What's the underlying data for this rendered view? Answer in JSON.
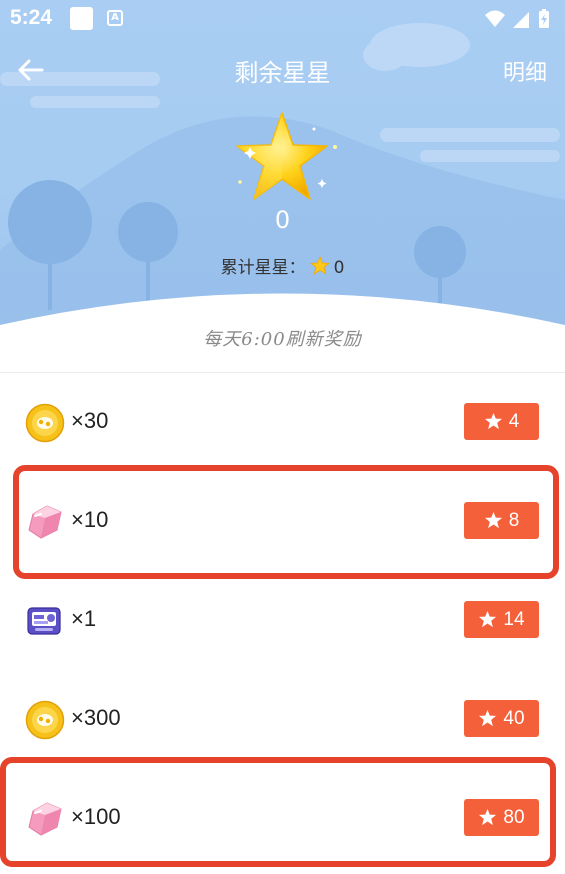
{
  "status_bar": {
    "time": "5:24",
    "a_badge": "A"
  },
  "header": {
    "title": "剩余星星",
    "detail_label": "明细"
  },
  "stars": {
    "remaining": "0",
    "total_label": "累计星星：",
    "total_value": "0"
  },
  "refresh_note": "每天6:00刷新奖励",
  "rewards": [
    {
      "icon": "gold-coin-icon",
      "qty": "×30",
      "price": "4"
    },
    {
      "icon": "pink-gem-icon",
      "qty": "×10",
      "price": "8"
    },
    {
      "icon": "voucher-card-icon",
      "qty": "×1",
      "price": "14"
    },
    {
      "icon": "gold-coin-icon",
      "qty": "×300",
      "price": "40"
    },
    {
      "icon": "pink-gem-icon",
      "qty": "×100",
      "price": "80"
    }
  ],
  "colors": {
    "accent": "#f4603a",
    "highlight": "#e5432c",
    "sky": "#a6ccf2"
  }
}
